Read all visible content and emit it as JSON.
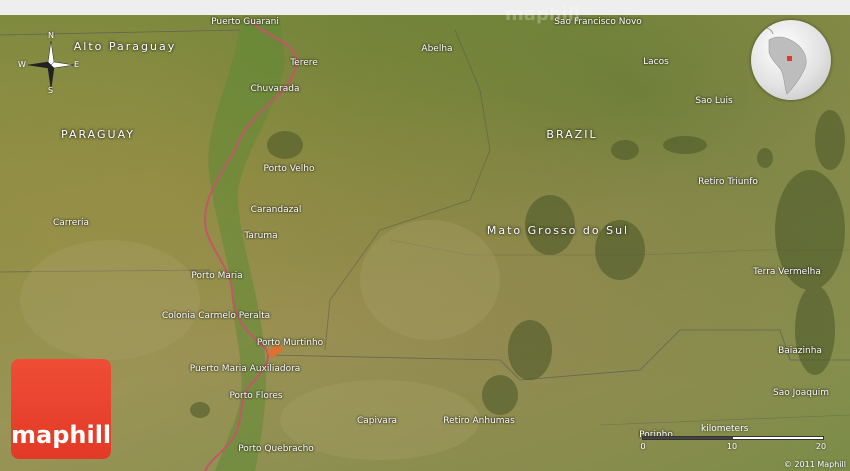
{
  "map": {
    "watermark": "maphill",
    "regions": [
      {
        "id": "alto-paraguay",
        "label": "Alto Paraguay"
      },
      {
        "id": "paraguay",
        "label": "PARAGUAY"
      },
      {
        "id": "brazil",
        "label": "BRAZIL"
      },
      {
        "id": "mato-grosso-do-sul",
        "label": "Mato Grosso do Sul"
      }
    ],
    "places": [
      {
        "id": "puerto-guarani",
        "label": "Puerto Guarani"
      },
      {
        "id": "terere",
        "label": "Terere"
      },
      {
        "id": "chuvarada",
        "label": "Chuvarada"
      },
      {
        "id": "porto-velho",
        "label": "Porto Velho"
      },
      {
        "id": "carandazal",
        "label": "Carandazal"
      },
      {
        "id": "taruma",
        "label": "Taruma"
      },
      {
        "id": "porto-maria",
        "label": "Porto Maria"
      },
      {
        "id": "colonia-carmelo-peralta",
        "label": "Colonia Carmelo Peralta"
      },
      {
        "id": "porto-murtinho",
        "label": "Porto Murtinho"
      },
      {
        "id": "puerto-maria-auxiliadora",
        "label": "Puerto Maria Auxiliadora"
      },
      {
        "id": "porto-flores",
        "label": "Porto Flores"
      },
      {
        "id": "porto-quebracho",
        "label": "Porto Quebracho"
      },
      {
        "id": "carreria",
        "label": "Carreria"
      },
      {
        "id": "abelha",
        "label": "Abelha"
      },
      {
        "id": "sao-francisco-novo",
        "label": "Sao Francisco Novo"
      },
      {
        "id": "lacos",
        "label": "Lacos"
      },
      {
        "id": "sao-luis",
        "label": "Sao Luis"
      },
      {
        "id": "retiro-triunfo",
        "label": "Retiro Triunfo"
      },
      {
        "id": "terra-vermelha",
        "label": "Terra Vermelha"
      },
      {
        "id": "baiazinha",
        "label": "Baiazinha"
      },
      {
        "id": "sao-joaquim",
        "label": "Sao Joaquim"
      },
      {
        "id": "capivara",
        "label": "Capivara"
      },
      {
        "id": "retiro-anhumas",
        "label": "Retiro Anhumas"
      },
      {
        "id": "porinho",
        "label": "Porinho"
      }
    ]
  },
  "compass": {
    "n": "N",
    "s": "S",
    "e": "E",
    "w": "W"
  },
  "scale": {
    "title": "kilometers",
    "ticks": [
      "0",
      "10",
      "20"
    ]
  },
  "logo": {
    "text": "maphill"
  },
  "copyright": "© 2011 Maphill",
  "colors": {
    "logo": "#e23a26",
    "river": "#c0586a",
    "road": "#555555"
  }
}
